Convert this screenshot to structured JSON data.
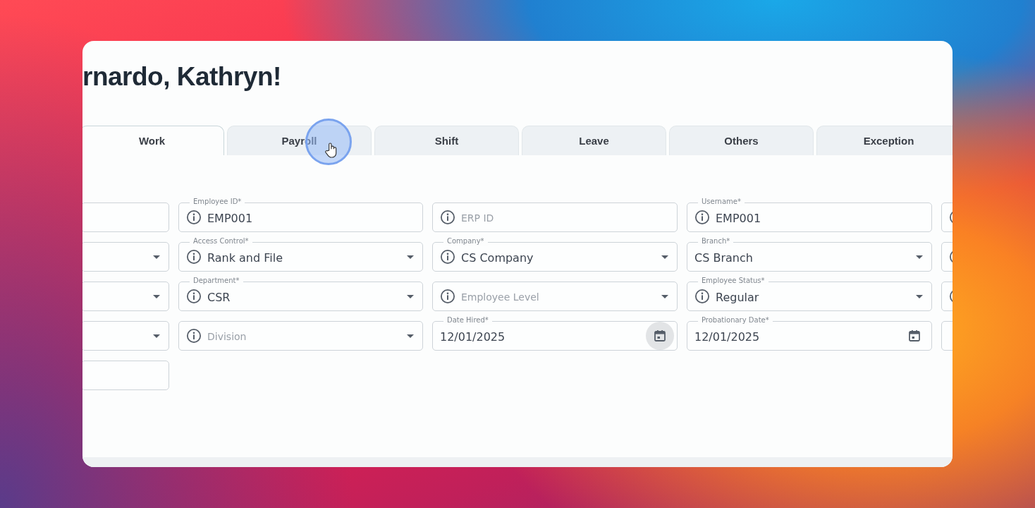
{
  "heading": "rnardo, Kathryn!",
  "tabs": [
    {
      "label": "Work",
      "selected": true
    },
    {
      "label": "Payroll",
      "selected": false
    },
    {
      "label": "Shift",
      "selected": false
    },
    {
      "label": "Leave",
      "selected": false
    },
    {
      "label": "Others",
      "selected": false
    },
    {
      "label": "Exception",
      "selected": false
    }
  ],
  "form_rows": [
    {
      "fields": [
        {
          "kind": "text",
          "info": false
        },
        {
          "kind": "text",
          "label": "Employee ID*",
          "value": "EMP001",
          "info": true
        },
        {
          "kind": "text",
          "placeholder": "ERP ID",
          "info": true
        },
        {
          "kind": "text",
          "label": "Username*",
          "value": "EMP001",
          "info": true
        },
        {
          "kind": "text",
          "info": true
        }
      ]
    },
    {
      "fields": [
        {
          "kind": "select",
          "info": false
        },
        {
          "kind": "select",
          "label": "Access Control*",
          "value": "Rank and File",
          "info": true
        },
        {
          "kind": "select",
          "label": "Company*",
          "value": "CS Company",
          "info": true
        },
        {
          "kind": "select",
          "label": "Branch*",
          "value": "CS Branch",
          "info": false
        },
        {
          "kind": "text",
          "info": true
        }
      ]
    },
    {
      "fields": [
        {
          "kind": "select",
          "info": false
        },
        {
          "kind": "select",
          "label": "Department*",
          "value": "CSR",
          "info": true
        },
        {
          "kind": "select",
          "placeholder": "Employee Level",
          "info": true
        },
        {
          "kind": "select",
          "label": "Employee Status*",
          "value": "Regular",
          "info": true
        },
        {
          "kind": "text",
          "info": true
        }
      ]
    },
    {
      "fields": [
        {
          "kind": "select",
          "info": false
        },
        {
          "kind": "select",
          "placeholder": "Division",
          "info": true
        },
        {
          "kind": "date",
          "label": "Date Hired*",
          "value": "12/01/2025",
          "info": false,
          "icon_hovered": true
        },
        {
          "kind": "date",
          "label": "Probationary Date*",
          "value": "12/01/2025",
          "info": false,
          "icon_hovered": false
        },
        {
          "kind": "text",
          "info": false
        }
      ]
    },
    {
      "fields": [
        {
          "kind": "text",
          "info": false
        }
      ]
    }
  ]
}
